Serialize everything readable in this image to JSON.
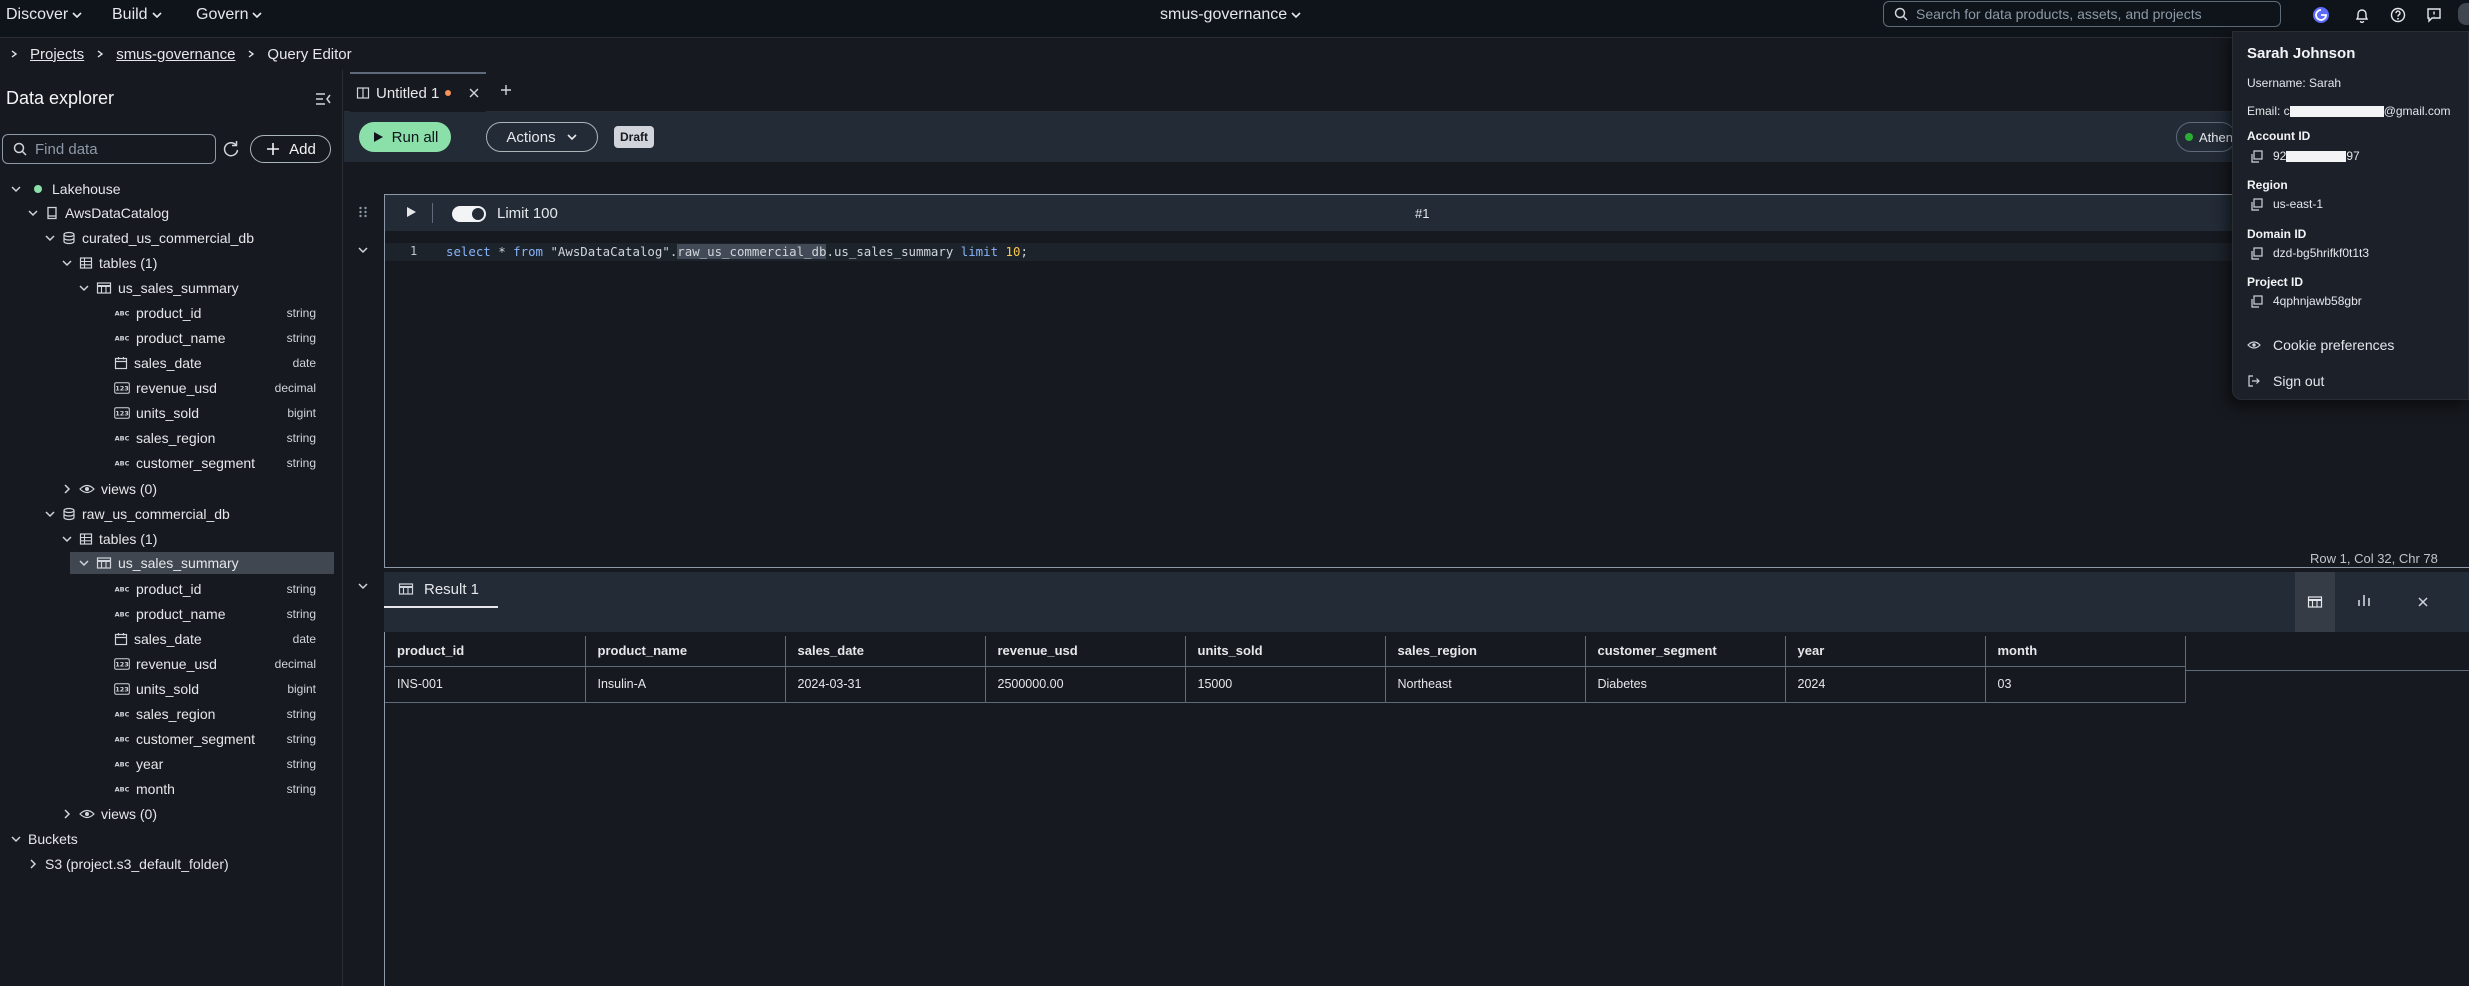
{
  "topnav": {
    "menus": [
      {
        "label": "Discover"
      },
      {
        "label": "Build"
      },
      {
        "label": "Govern"
      }
    ],
    "project_name": "smus-governance",
    "search_placeholder": "Search for data products, assets, and projects"
  },
  "breadcrumb": {
    "items": [
      {
        "label": "Projects"
      },
      {
        "label": "smus-governance"
      },
      {
        "label": "Query Editor"
      }
    ]
  },
  "explorer": {
    "title": "Data explorer",
    "find_placeholder": "Find data",
    "add_label": "Add",
    "lakehouse": "Lakehouse",
    "catalog": "AwsDataCatalog",
    "db1": {
      "name": "curated_us_commercial_db",
      "tables_label": "tables (1)",
      "table": "us_sales_summary",
      "views_label": "views (0)",
      "columns": [
        {
          "name": "product_id",
          "type": "string",
          "icon": "abc"
        },
        {
          "name": "product_name",
          "type": "string",
          "icon": "abc"
        },
        {
          "name": "sales_date",
          "type": "date",
          "icon": "calendar"
        },
        {
          "name": "revenue_usd",
          "type": "decimal",
          "icon": "123"
        },
        {
          "name": "units_sold",
          "type": "bigint",
          "icon": "123"
        },
        {
          "name": "sales_region",
          "type": "string",
          "icon": "abc"
        },
        {
          "name": "customer_segment",
          "type": "string",
          "icon": "abc"
        }
      ]
    },
    "db2": {
      "name": "raw_us_commercial_db",
      "tables_label": "tables (1)",
      "table": "us_sales_summary",
      "views_label": "views (0)",
      "columns": [
        {
          "name": "product_id",
          "type": "string",
          "icon": "abc"
        },
        {
          "name": "product_name",
          "type": "string",
          "icon": "abc"
        },
        {
          "name": "sales_date",
          "type": "date",
          "icon": "calendar"
        },
        {
          "name": "revenue_usd",
          "type": "decimal",
          "icon": "123"
        },
        {
          "name": "units_sold",
          "type": "bigint",
          "icon": "123"
        },
        {
          "name": "sales_region",
          "type": "string",
          "icon": "abc"
        },
        {
          "name": "customer_segment",
          "type": "string",
          "icon": "abc"
        },
        {
          "name": "year",
          "type": "string",
          "icon": "abc"
        },
        {
          "name": "month",
          "type": "string",
          "icon": "abc"
        }
      ]
    },
    "buckets": "Buckets",
    "bucket_item": "S3 (project.s3_default_folder)"
  },
  "editor": {
    "tab_label": "Untitled 1",
    "run_all": "Run all",
    "actions": "Actions",
    "draft": "Draft",
    "engine": "Athena",
    "limit_label": "Limit 100",
    "cell_number": "#1",
    "line_number": "1",
    "code": {
      "p1": "select",
      "p2": " * ",
      "p3": "from",
      "p4": " \"AwsDataCatalog\".",
      "p5": "raw_us_commercial_db",
      "p6": ".us_sales_summary ",
      "p7": "limit",
      "p8": " ",
      "p9": "10",
      "p10": ";"
    },
    "cursor_position": "Row 1,  Col 32,  Chr 78"
  },
  "result": {
    "tab_label": "Result 1",
    "columns": [
      "product_id",
      "product_name",
      "sales_date",
      "revenue_usd",
      "units_sold",
      "sales_region",
      "customer_segment",
      "year",
      "month"
    ],
    "rows": [
      [
        "INS-001",
        "Insulin-A",
        "2024-03-31",
        "2500000.00",
        "15000",
        "Northeast",
        "Diabetes",
        "2024",
        "03"
      ]
    ]
  },
  "user_menu": {
    "name": "Sarah Johnson",
    "username": "Username: Sarah",
    "email_prefix": "Email: c",
    "email_suffix": "@gmail.com",
    "account_label": "Account ID",
    "account_prefix": "92",
    "account_suffix": "97",
    "region_label": "Region",
    "region_value": "us-east-1",
    "domain_label": "Domain ID",
    "domain_value": "dzd-bg5hrifkf0t1t3",
    "project_label": "Project ID",
    "project_value": "4qphnjawb58gbr",
    "cookie": "Cookie preferences",
    "signout": "Sign out"
  },
  "colors": {
    "background": "#16191f",
    "run_button": "#8ae0a8",
    "dirty_dot": "#f89256",
    "status_green": "#29ad32",
    "lakehouse_dot": "#8ae0a8"
  }
}
